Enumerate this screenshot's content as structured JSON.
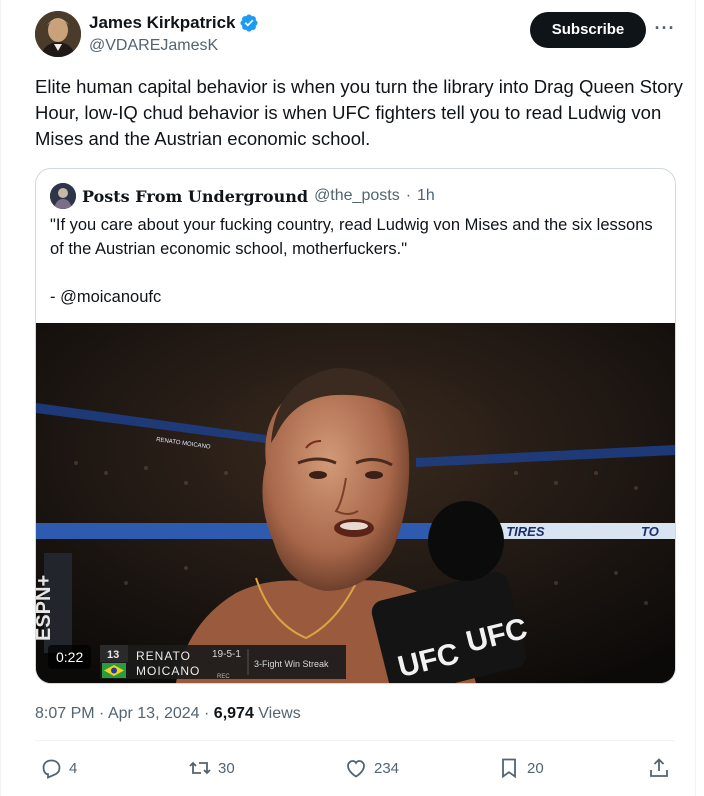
{
  "author": {
    "name": "James Kirkpatrick",
    "handle": "@VDAREJamesK",
    "verified_icon": "verified-badge-icon",
    "subscribe_label": "Subscribe",
    "more_icon": "more-horizontal-icon"
  },
  "tweet": {
    "text": "Elite human capital behavior is when you turn the library into Drag Queen Story Hour, low-IQ chud behavior is when UFC fighters tell you to read Ludwig von Mises and the Austrian economic school."
  },
  "quote": {
    "name": "Posts From Underground",
    "handle": "@the_posts",
    "separator": "·",
    "time": "1h",
    "text": "\"If you care about your fucking country, read Ludwig von Mises and the six lessons of the Austrian economic school, motherfuckers.\"\n\n- @moicanoufc",
    "video": {
      "duration": "0:22",
      "lower_third": {
        "rank": "13",
        "first_name": "RENATO",
        "last_name": "MOICANO",
        "record": "19-5-1",
        "record_label": "REC",
        "streak": "3-Fight Win Streak"
      },
      "broadcaster_text": "ESPN+",
      "mic_text": "UFC",
      "banner_text": "TOYO TIRES",
      "banner_text_2": "TO",
      "banner_small": "RENATO MOICANO"
    }
  },
  "meta": {
    "time": "8:07 PM",
    "separator": "·",
    "date": "Apr 13, 2024",
    "views_count": "6,974",
    "views_label": "Views"
  },
  "actions": {
    "replies": "4",
    "reposts": "30",
    "likes": "234",
    "bookmarks": "20"
  },
  "colors": {
    "text_primary": "#0f1419",
    "text_secondary": "#536471",
    "verified": "#1d9bf0",
    "border": "#cfd9de"
  }
}
